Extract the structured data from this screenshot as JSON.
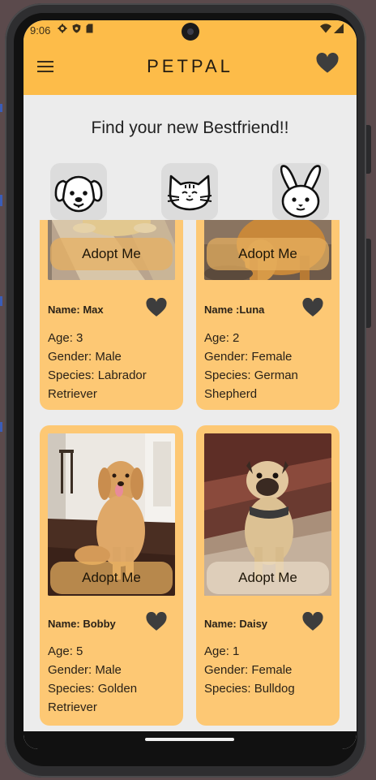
{
  "status_bar": {
    "time": "9:06",
    "left_icons": [
      "gear-icon",
      "shield-icon",
      "sim-card-icon"
    ],
    "right_icons": [
      "wifi-icon",
      "signal-icon"
    ]
  },
  "app_bar": {
    "title": "PETPAL",
    "menu_icon": "hamburger-menu-icon",
    "favorites_icon": "heart-icon"
  },
  "heading": "Find your new Bestfriend!!",
  "categories": [
    {
      "icon": "dog-face-icon",
      "selected": true
    },
    {
      "icon": "cat-face-icon",
      "selected": false
    },
    {
      "icon": "rabbit-face-icon",
      "selected": false
    }
  ],
  "pets": [
    {
      "adopt_label": "Adopt Me",
      "name": "Name: Max",
      "age": "Age: 3",
      "gender": "Gender: Male",
      "species": "Species: Labrador Retriever"
    },
    {
      "adopt_label": "Adopt Me",
      "name": "Name :Luna",
      "age": "Age: 2",
      "gender": "Gender: Female",
      "species": "Species: German Shepherd"
    },
    {
      "adopt_label": "Adopt Me",
      "name": "Name: Bobby",
      "age": "Age: 5",
      "gender": "Gender: Male",
      "species": "Species: Golden Retriever"
    },
    {
      "adopt_label": "Adopt Me",
      "name": "Name: Daisy",
      "age": "Age: 1",
      "gender": "Gender: Female",
      "species": "Species: Bulldog"
    }
  ],
  "colors": {
    "accent": "#fdbc49",
    "card": "#fdc874",
    "background": "#ececec",
    "icon_dark": "#3d3d3d"
  }
}
